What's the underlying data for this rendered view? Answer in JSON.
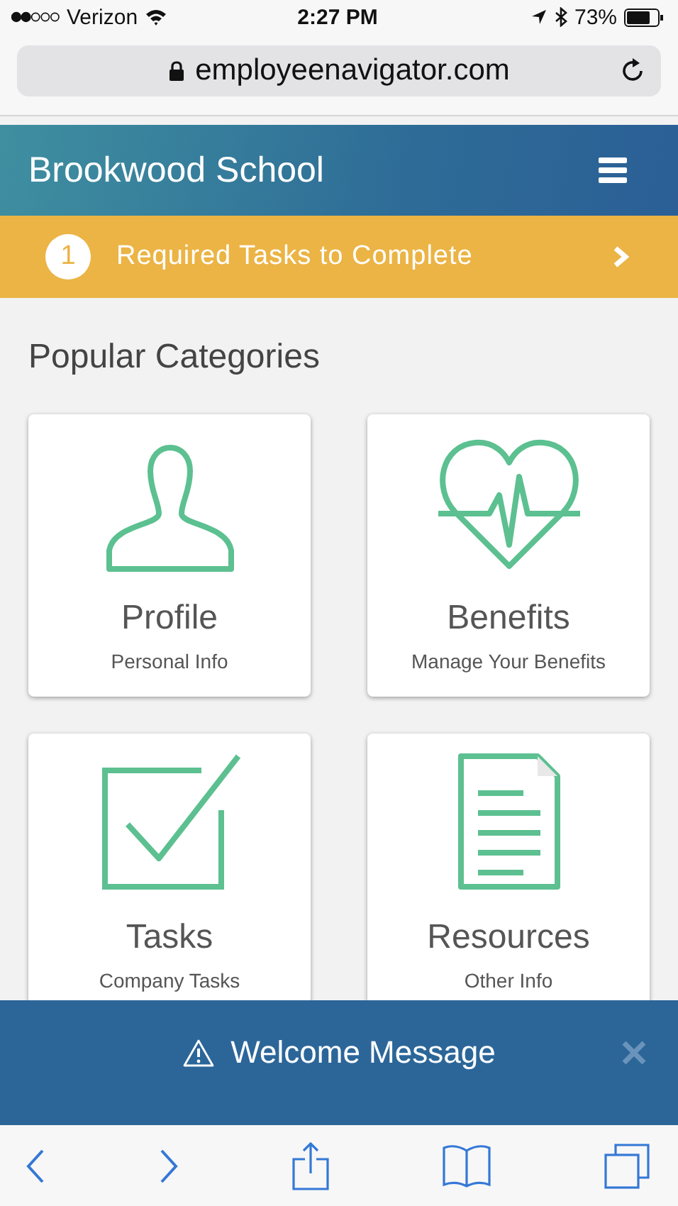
{
  "status_bar": {
    "carrier": "Verizon",
    "time": "2:27 PM",
    "battery": "73%"
  },
  "browser": {
    "url": "employeenavigator.com"
  },
  "header": {
    "title": "Brookwood School"
  },
  "alert": {
    "count": "1",
    "text": "Required Tasks to Complete"
  },
  "section_title": "Popular Categories",
  "categories": [
    {
      "kind": "profile",
      "title": "Profile",
      "subtitle": "Personal Info"
    },
    {
      "kind": "benefits",
      "title": "Benefits",
      "subtitle": "Manage Your Benefits"
    },
    {
      "kind": "tasks",
      "title": "Tasks",
      "subtitle": "Company Tasks"
    },
    {
      "kind": "resources",
      "title": "Resources",
      "subtitle": "Other Info"
    }
  ],
  "welcome": {
    "text": "Welcome Message"
  }
}
